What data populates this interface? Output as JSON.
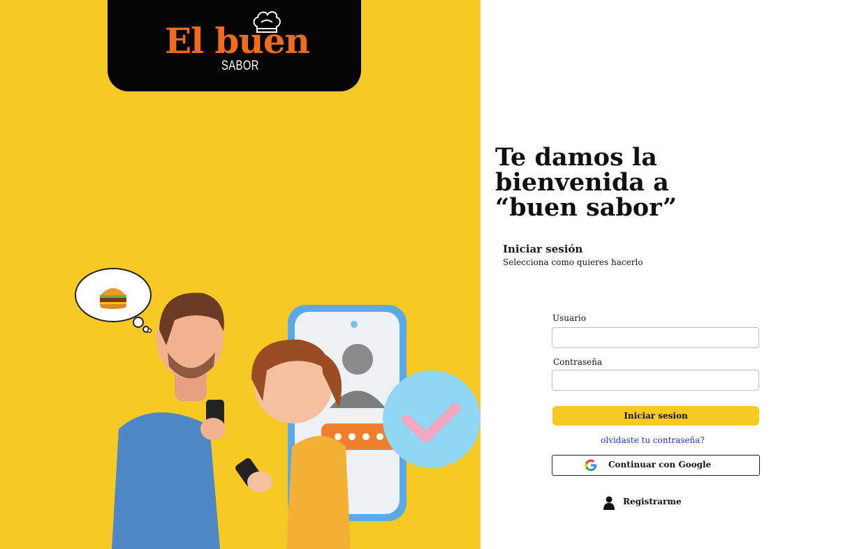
{
  "brand": {
    "logo_main": "El buen",
    "logo_sub": "SABOR"
  },
  "welcome": {
    "line1": "Te damos la",
    "line2": "bienvenida a",
    "line3": "“buen sabor”"
  },
  "login": {
    "title": "Iniciar sesión",
    "subtitle": "Selecciona como quieres hacerlo",
    "username_label": "Usuario",
    "username_value": "",
    "password_label": "Contraseña",
    "password_value": "",
    "submit_label": "Iniciar sesion",
    "forgot_label": "olvidaste tu contraseña?",
    "google_label": "Continuar con Google",
    "register_label": "Registrarme"
  },
  "colors": {
    "accent_yellow": "#f6c924",
    "logo_orange": "#f26a1b",
    "link_blue": "#1d35c9"
  },
  "icons": [
    "chef-hat-icon",
    "burger-icon",
    "google-icon",
    "user-icon",
    "check-icon"
  ]
}
